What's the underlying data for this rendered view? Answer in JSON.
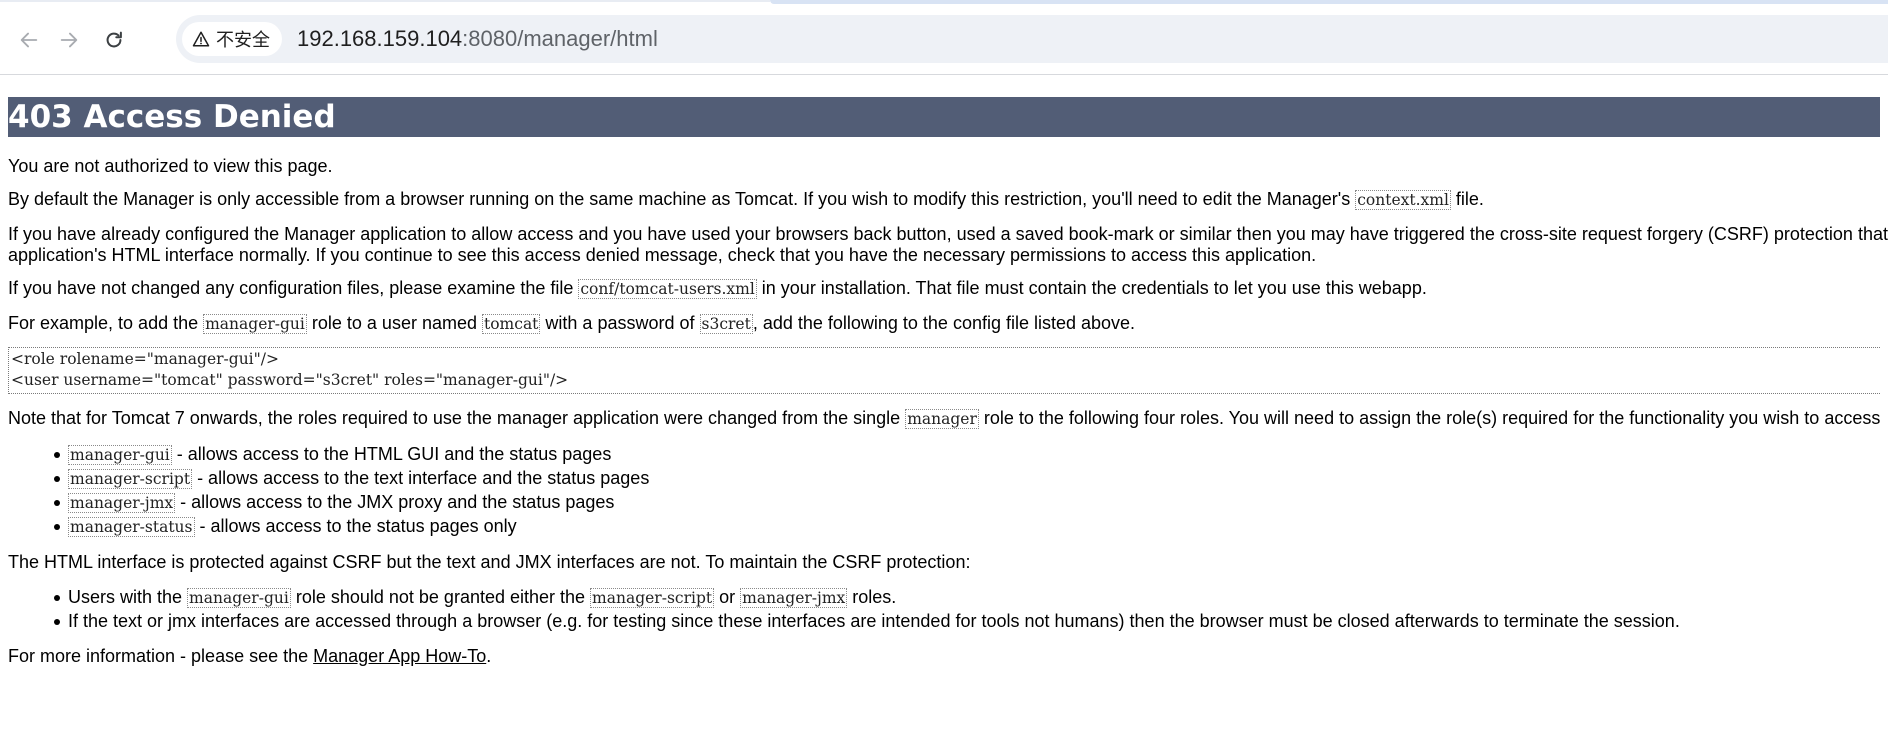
{
  "browser": {
    "security_label": "不安全",
    "url_host": "192.168.159.104",
    "url_path": ":8080/manager/html",
    "icons": [
      "back-arrow-icon",
      "forward-arrow-icon",
      "reload-icon",
      "warning-triangle-icon"
    ]
  },
  "page": {
    "title": "403 Access Denied",
    "p1": "You are not authorized to view this page.",
    "p2": {
      "before": "By default the Manager is only accessible from a browser running on the same machine as Tomcat. If you wish to modify this restriction, you'll need to edit the Manager's ",
      "code": "context.xml",
      "after": " file."
    },
    "p3": {
      "line1": "If you have already configured the Manager application to allow access and you have used your browsers back button, used a saved book-mark or similar then you may have triggered the cross-site request forgery (CSRF) protection that",
      "line2": "application's HTML interface normally. If you continue to see this access denied message, check that you have the necessary permissions to access this application."
    },
    "p4": {
      "before": "If you have not changed any configuration files, please examine the file ",
      "code": "conf/tomcat-users.xml",
      "after": " in your installation. That file must contain the credentials to let you use this webapp."
    },
    "p5": {
      "t1": "For example, to add the ",
      "c1": "manager-gui",
      "t2": " role to a user named ",
      "c2": "tomcat",
      "t3": " with a password of ",
      "c3": "s3cret",
      "t4": ", add the following to the config file listed above."
    },
    "snippet": {
      "line1": "<role rolename=\"manager-gui\"/>",
      "line2": "<user username=\"tomcat\" password=\"s3cret\" roles=\"manager-gui\"/>"
    },
    "p6": {
      "before": "Note that for Tomcat 7 onwards, the roles required to use the manager application were changed from the single ",
      "code": "manager",
      "after": " role to the following four roles. You will need to assign the role(s) required for the functionality you wish to access"
    },
    "roles": [
      {
        "code": "manager-gui",
        "text": " - allows access to the HTML GUI and the status pages"
      },
      {
        "code": "manager-script",
        "text": " - allows access to the text interface and the status pages"
      },
      {
        "code": "manager-jmx",
        "text": " - allows access to the JMX proxy and the status pages"
      },
      {
        "code": "manager-status",
        "text": " - allows access to the status pages only"
      }
    ],
    "p7": "The HTML interface is protected against CSRF but the text and JMX interfaces are not. To maintain the CSRF protection:",
    "csrf1": {
      "t1": "Users with the ",
      "c1": "manager-gui",
      "t2": " role should not be granted either the ",
      "c2": "manager-script",
      "t3": " or ",
      "c3": "manager-jmx",
      "t4": " roles."
    },
    "csrf2": "If the text or jmx interfaces are accessed through a browser (e.g. for testing since these interfaces are intended for tools not humans) then the browser must be closed afterwards to terminate the session.",
    "p8": {
      "before": "For more information - please see the ",
      "link": "Manager App How-To",
      "after": "."
    }
  },
  "colors": {
    "title_bar": "#525d76",
    "omnibox_bg": "#eef1f6"
  }
}
